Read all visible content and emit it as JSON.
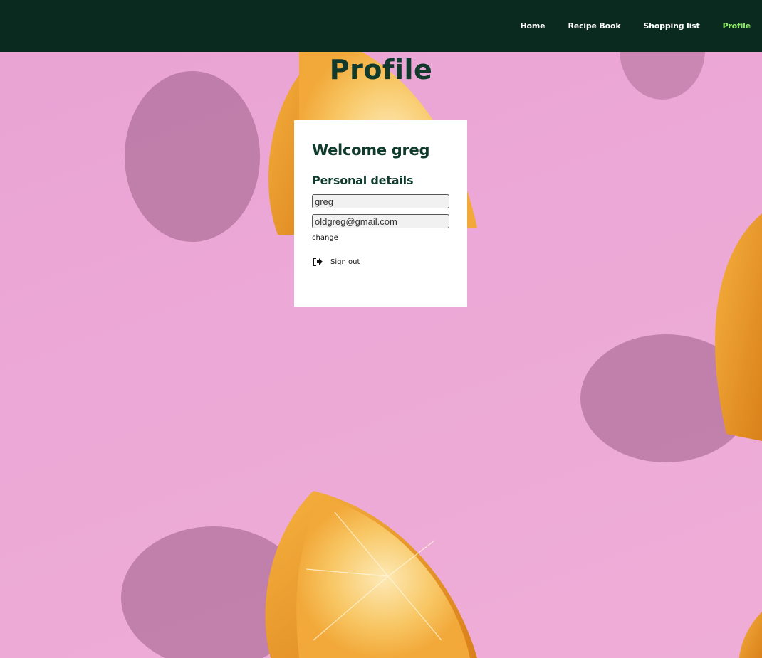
{
  "nav": {
    "links": [
      {
        "label": "Home",
        "active": false
      },
      {
        "label": "Recipe Book",
        "active": false
      },
      {
        "label": "Shopping list",
        "active": false
      },
      {
        "label": "Profile",
        "active": true
      }
    ]
  },
  "page": {
    "title": "Profile"
  },
  "profile": {
    "welcome": "Welcome greg",
    "section_title": "Personal details",
    "name_value": "greg",
    "email_value": "oldgreg@gmail.com",
    "change_label": "change",
    "signout_label": "Sign out",
    "signout_icon": "sign-out-icon"
  },
  "colors": {
    "nav_bg": "#0a2a1f",
    "active_link": "#8ee86a",
    "heading": "#0f3a2c",
    "background": "#eaa6d6",
    "orange": "#f0a326"
  }
}
